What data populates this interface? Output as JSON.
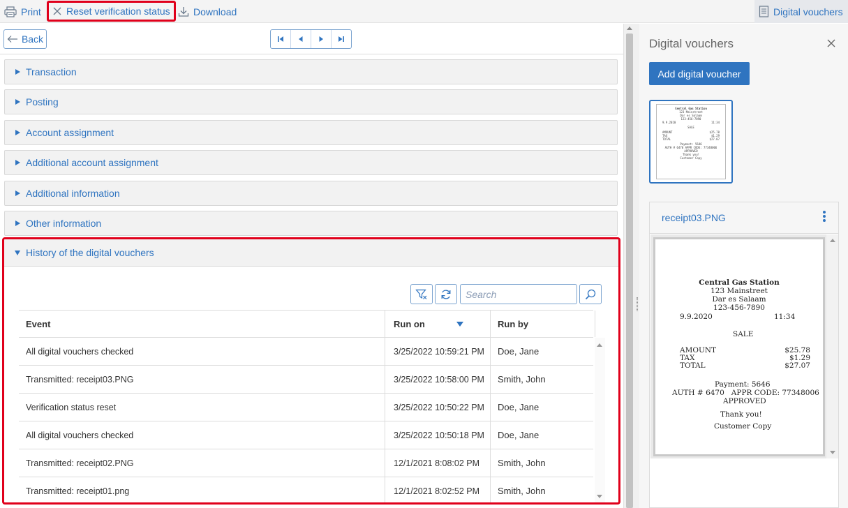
{
  "toolbar": {
    "print": "Print",
    "reset": "Reset verification status",
    "download": "Download",
    "digital_vouchers": "Digital vouchers"
  },
  "nav": {
    "back": "Back"
  },
  "sections": [
    "Transaction",
    "Posting",
    "Account assignment",
    "Additional account assignment",
    "Additional information",
    "Other information"
  ],
  "history": {
    "title": "History of the digital vouchers",
    "search_placeholder": "Search",
    "columns": {
      "event": "Event",
      "run_on": "Run on",
      "run_by": "Run by"
    },
    "rows": [
      {
        "event": "All digital vouchers checked",
        "run_on": "3/25/2022 10:59:21 PM",
        "run_by": "Doe, Jane"
      },
      {
        "event": "Transmitted: receipt03.PNG",
        "run_on": "3/25/2022 10:58:00 PM",
        "run_by": "Smith, John"
      },
      {
        "event": "Verification status reset",
        "run_on": "3/25/2022 10:50:22 PM",
        "run_by": "Doe, Jane"
      },
      {
        "event": "All digital vouchers checked",
        "run_on": "3/25/2022 10:50:18 PM",
        "run_by": "Doe, Jane"
      },
      {
        "event": "Transmitted: receipt02.PNG",
        "run_on": "12/1/2021 8:08:02 PM",
        "run_by": "Smith, John"
      },
      {
        "event": "Transmitted: receipt01.png",
        "run_on": "12/1/2021 8:02:52 PM",
        "run_by": "Smith, John"
      }
    ]
  },
  "right_panel": {
    "title": "Digital vouchers",
    "add_button": "Add digital voucher",
    "file_name": "receipt03.PNG"
  },
  "receipt": {
    "name": "Central Gas Station",
    "street": "123 Mainstreet",
    "city": "Dar es Salaam",
    "phone": "123-456-7890",
    "date": "9.9.2020",
    "time": "11:34",
    "type": "SALE",
    "amount_label": "AMOUNT",
    "amount": "$25.78",
    "tax_label": "TAX",
    "tax": "$1.29",
    "total_label": "TOTAL",
    "total": "$27.07",
    "payment": "Payment: 5646",
    "auth": "AUTH # 6470   APPR CODE: 77348006",
    "approved": "APPROVED",
    "thanks": "Thank you!",
    "copy": "Customer Copy"
  },
  "colors": {
    "accent": "#2f74c0",
    "highlight": "#e0001b"
  }
}
